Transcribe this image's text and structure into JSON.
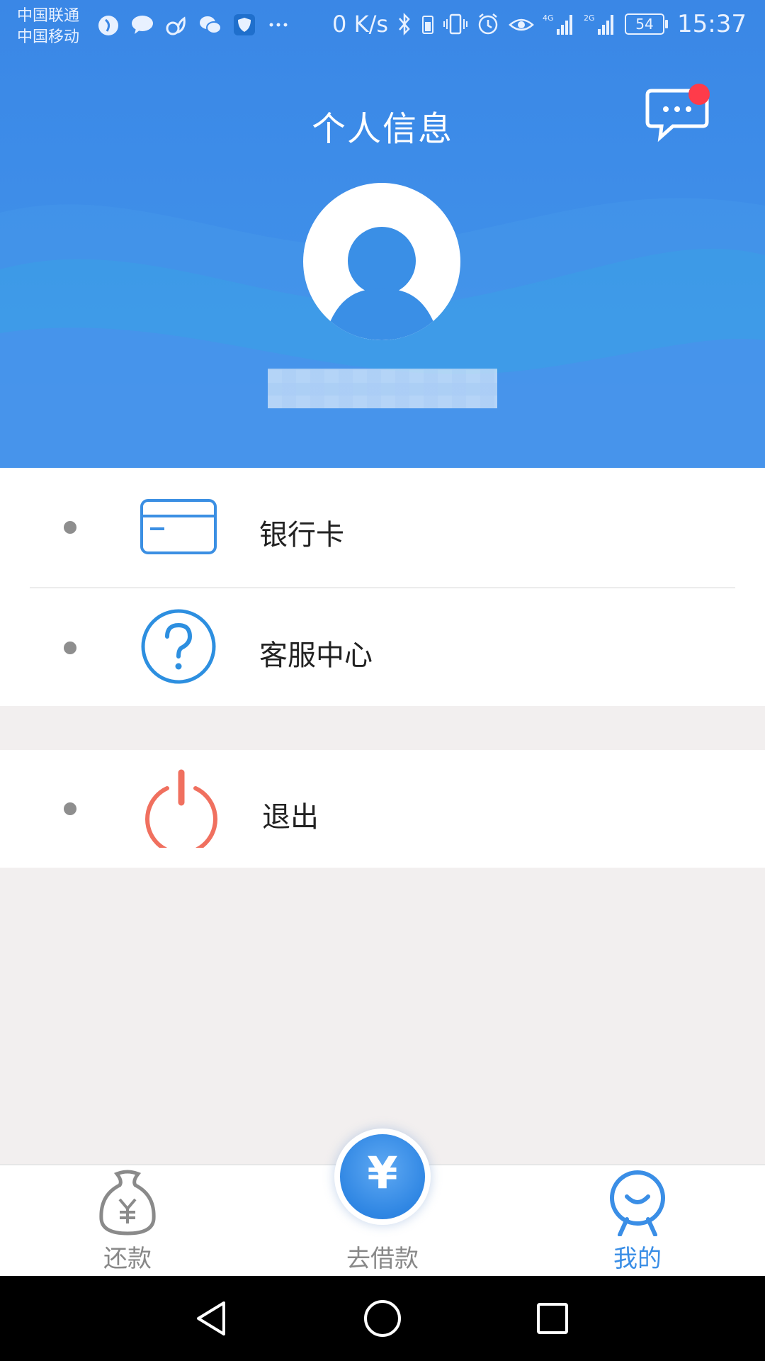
{
  "status_bar": {
    "carrier_1": "中国联通",
    "carrier_2": "中国移动",
    "network_speed": "0 K/s",
    "signal_1_type": "4G",
    "signal_2_type": "2G",
    "battery": "54",
    "time": "15:37",
    "icons": [
      "app-icon",
      "chat-bubble-icon",
      "squirrel-icon",
      "wechat-icon",
      "shield-icon",
      "more-dots-icon",
      "bluetooth-icon",
      "battery-small-icon",
      "vibrate-icon",
      "alarm-icon",
      "eye-icon",
      "signal-icon",
      "signal-icon"
    ]
  },
  "header": {
    "title": "个人信息",
    "message_icon": "chat-message-icon",
    "has_notification": true,
    "avatar_icon": "user-avatar-icon"
  },
  "menu": {
    "items": [
      {
        "label": "银行卡",
        "icon": "bank-card-icon"
      },
      {
        "label": "客服中心",
        "icon": "help-question-icon"
      },
      {
        "label": "退出",
        "icon": "power-icon"
      }
    ]
  },
  "tabbar": {
    "tabs": [
      {
        "label": "还款",
        "icon": "money-bag-icon",
        "active": false
      },
      {
        "label": "去借款",
        "icon": "yen-circle-icon",
        "active": false
      },
      {
        "label": "我的",
        "icon": "profile-smile-icon",
        "active": true
      }
    ],
    "borrow_symbol": "¥",
    "active_color": "#3a8ee6",
    "inactive_color": "#888888"
  },
  "colors": {
    "header_blue": "#3a87e6",
    "badge_red": "#ff3b4a",
    "logout_red": "#f0705f",
    "icon_blue": "#2d8fe0"
  }
}
